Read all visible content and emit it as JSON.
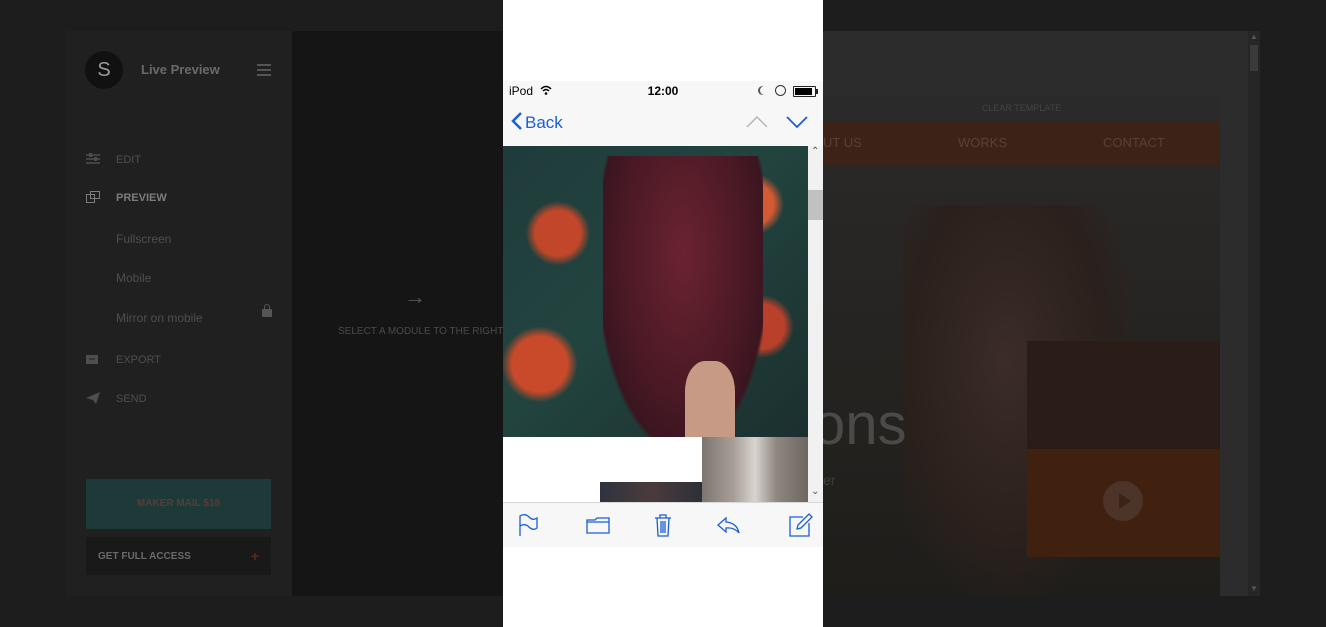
{
  "app": {
    "logo_letter": "S",
    "title": "Live Preview",
    "nav": [
      {
        "label": "EDIT",
        "icon": "sliders-icon"
      },
      {
        "label": "PREVIEW",
        "icon": "preview-icon"
      },
      {
        "label": "Fullscreen"
      },
      {
        "label": "Mobile"
      },
      {
        "label": "Mirror on mobile",
        "icon": "lock-icon"
      },
      {
        "label": "EXPORT",
        "icon": "export-icon"
      },
      {
        "label": "SEND",
        "icon": "send-icon"
      }
    ],
    "promo_label": "MAKER MAIL $18",
    "access": {
      "label": "GET FULL ACCESS",
      "plus": "+"
    }
  },
  "canvas": {
    "arrow": "→",
    "hint": "SELECT A MODULE TO THE RIGHT"
  },
  "template": {
    "bar_label": "CLEAR TEMPLATE",
    "nav": [
      "UT US",
      "WORKS",
      "CONTACT"
    ],
    "hero_text": "ons",
    "hero_sub": "er"
  },
  "phone": {
    "carrier": "iPod",
    "time": "12:00",
    "back_label": "Back",
    "toolbar": [
      "flag-icon",
      "folder-icon",
      "trash-icon",
      "reply-icon",
      "compose-icon"
    ]
  },
  "colors": {
    "ios_blue": "#1a5fd6",
    "template_accent": "#e8541c"
  }
}
